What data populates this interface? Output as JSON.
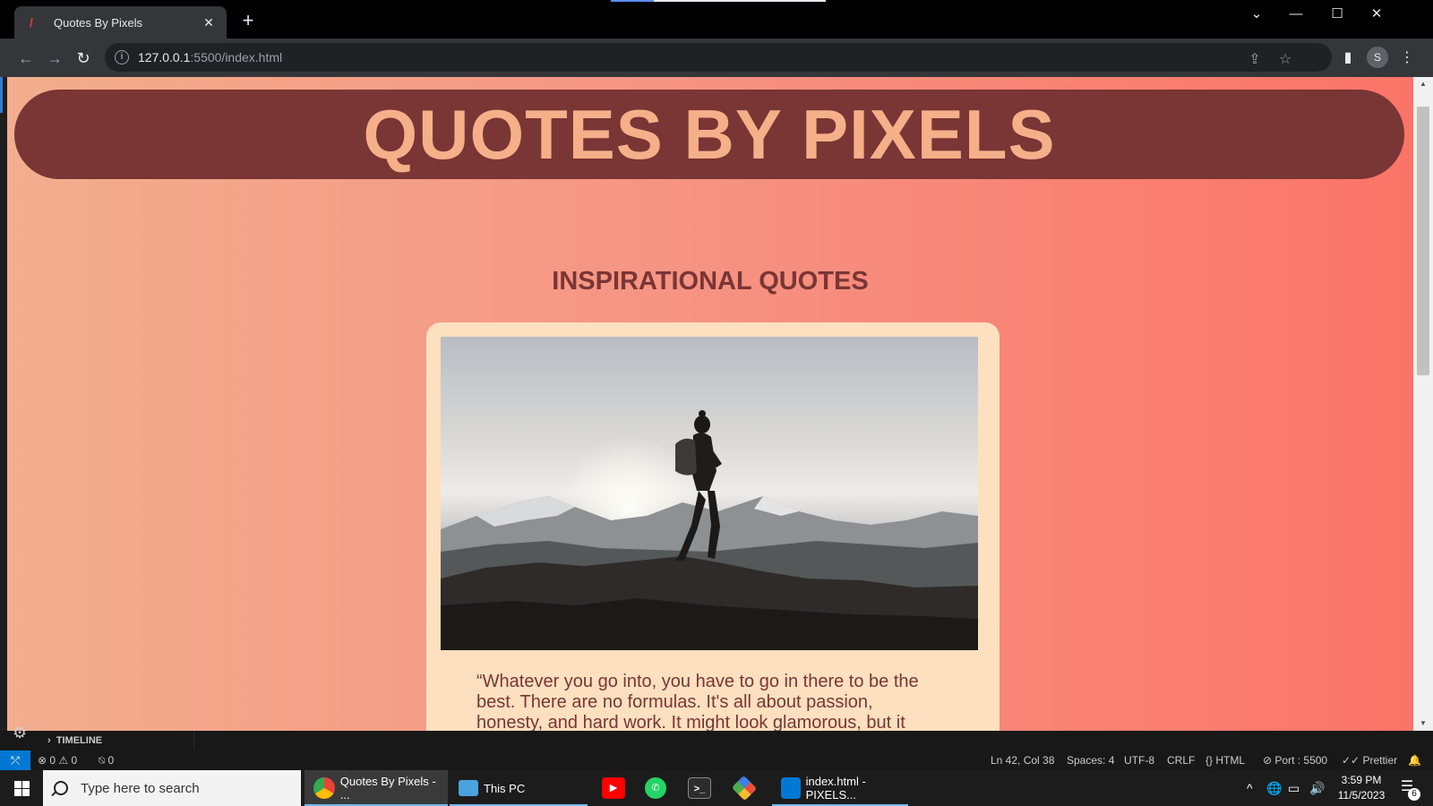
{
  "browser": {
    "tab_title": "Quotes By Pixels",
    "url_host": "127.0.0.1",
    "url_path": ":5500/index.html",
    "profile_initial": "S",
    "icons": [
      "back-icon",
      "forward-icon",
      "reload-icon",
      "info-icon",
      "share-icon",
      "star-icon",
      "side-panel-icon",
      "menu-icon"
    ]
  },
  "page": {
    "site_title": "QUOTES BY PIXELS",
    "section_heading": "INSPIRATIONAL QUOTES",
    "quote_text": "“Whatever you go into, you have to go in there to be the best. There are no formulas. It's all about passion, honesty, and hard work. It might look glamorous, but it",
    "colors": {
      "banner": "#7a3535",
      "title": "#f5b08a",
      "card": "#fde0bf",
      "gradient_left": "#f2ae8e",
      "gradient_right": "#fb7468"
    }
  },
  "vscode": {
    "timeline_label": "TIMELINE",
    "errors": "0",
    "warnings": "0",
    "ports_count": "0",
    "cursor_position": "Ln 42, Col 38",
    "spaces": "Spaces: 4",
    "encoding": "UTF-8",
    "line_ending": "CRLF",
    "language": "HTML",
    "port": "Port : 5500",
    "formatter": "Prettier"
  },
  "taskbar": {
    "search_placeholder": "Type here to search",
    "items": [
      {
        "label": "Quotes By Pixels - ..."
      },
      {
        "label": "This PC"
      },
      {
        "label": "index.html - PIXELS..."
      }
    ],
    "time": "3:59 PM",
    "date": "11/5/2023",
    "notification_count": "6"
  }
}
